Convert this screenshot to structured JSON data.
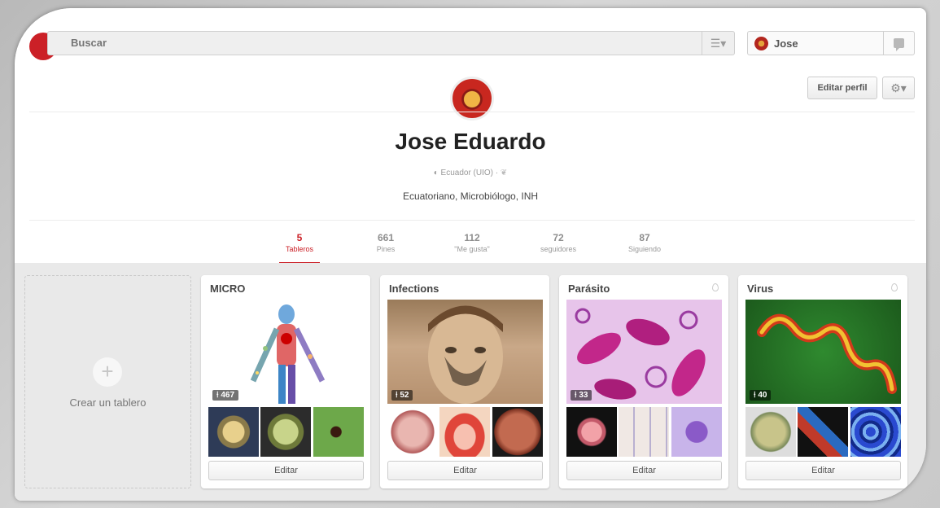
{
  "search": {
    "placeholder": "Buscar"
  },
  "user": {
    "name": "Jose"
  },
  "profile": {
    "name": "Jose Eduardo",
    "location": "Ecuador (UIO)",
    "bio": "Ecuatoriano, Microbiólogo, INH",
    "edit_label": "Editar perfil"
  },
  "stats": [
    {
      "num": "5",
      "label": "Tableros"
    },
    {
      "num": "661",
      "label": "Pines"
    },
    {
      "num": "112",
      "label": "\"Me gusta\""
    },
    {
      "num": "72",
      "label": "seguidores"
    },
    {
      "num": "87",
      "label": "Siguiendo"
    }
  ],
  "create_board_label": "Crear un tablero",
  "boards": [
    {
      "title": "MICRO",
      "pins": "467",
      "edit": "Editar"
    },
    {
      "title": "Infections",
      "pins": "52",
      "edit": "Editar"
    },
    {
      "title": "Parásito",
      "pins": "33",
      "edit": "Editar"
    },
    {
      "title": "Virus",
      "pins": "40",
      "edit": "Editar"
    }
  ],
  "colors": {
    "accent": "#cb2027",
    "background": "#e9e9e9"
  }
}
